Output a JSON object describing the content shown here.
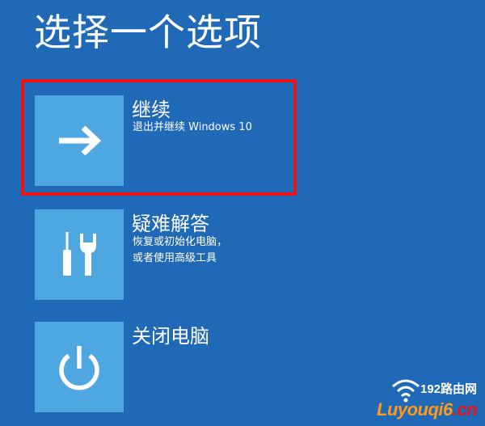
{
  "page": {
    "title": "选择一个选项"
  },
  "options": [
    {
      "title": "继续",
      "description": "退出并继续 Windows 10",
      "icon": "arrow-right-icon"
    },
    {
      "title": "疑难解答",
      "description_line1": "恢复或初始化电脑，",
      "description_line2": "或者使用高级工具",
      "icon": "tools-icon"
    },
    {
      "title": "关闭电脑",
      "icon": "power-icon"
    }
  ],
  "watermark": {
    "top_text": "192路由网",
    "bottom_text": "Luyouqi6",
    "bottom_suffix": ".cn"
  },
  "colors": {
    "background": "#1f69b7",
    "tile": "#4ea7e0",
    "highlight": "#ee1111",
    "text": "#ffffff"
  }
}
